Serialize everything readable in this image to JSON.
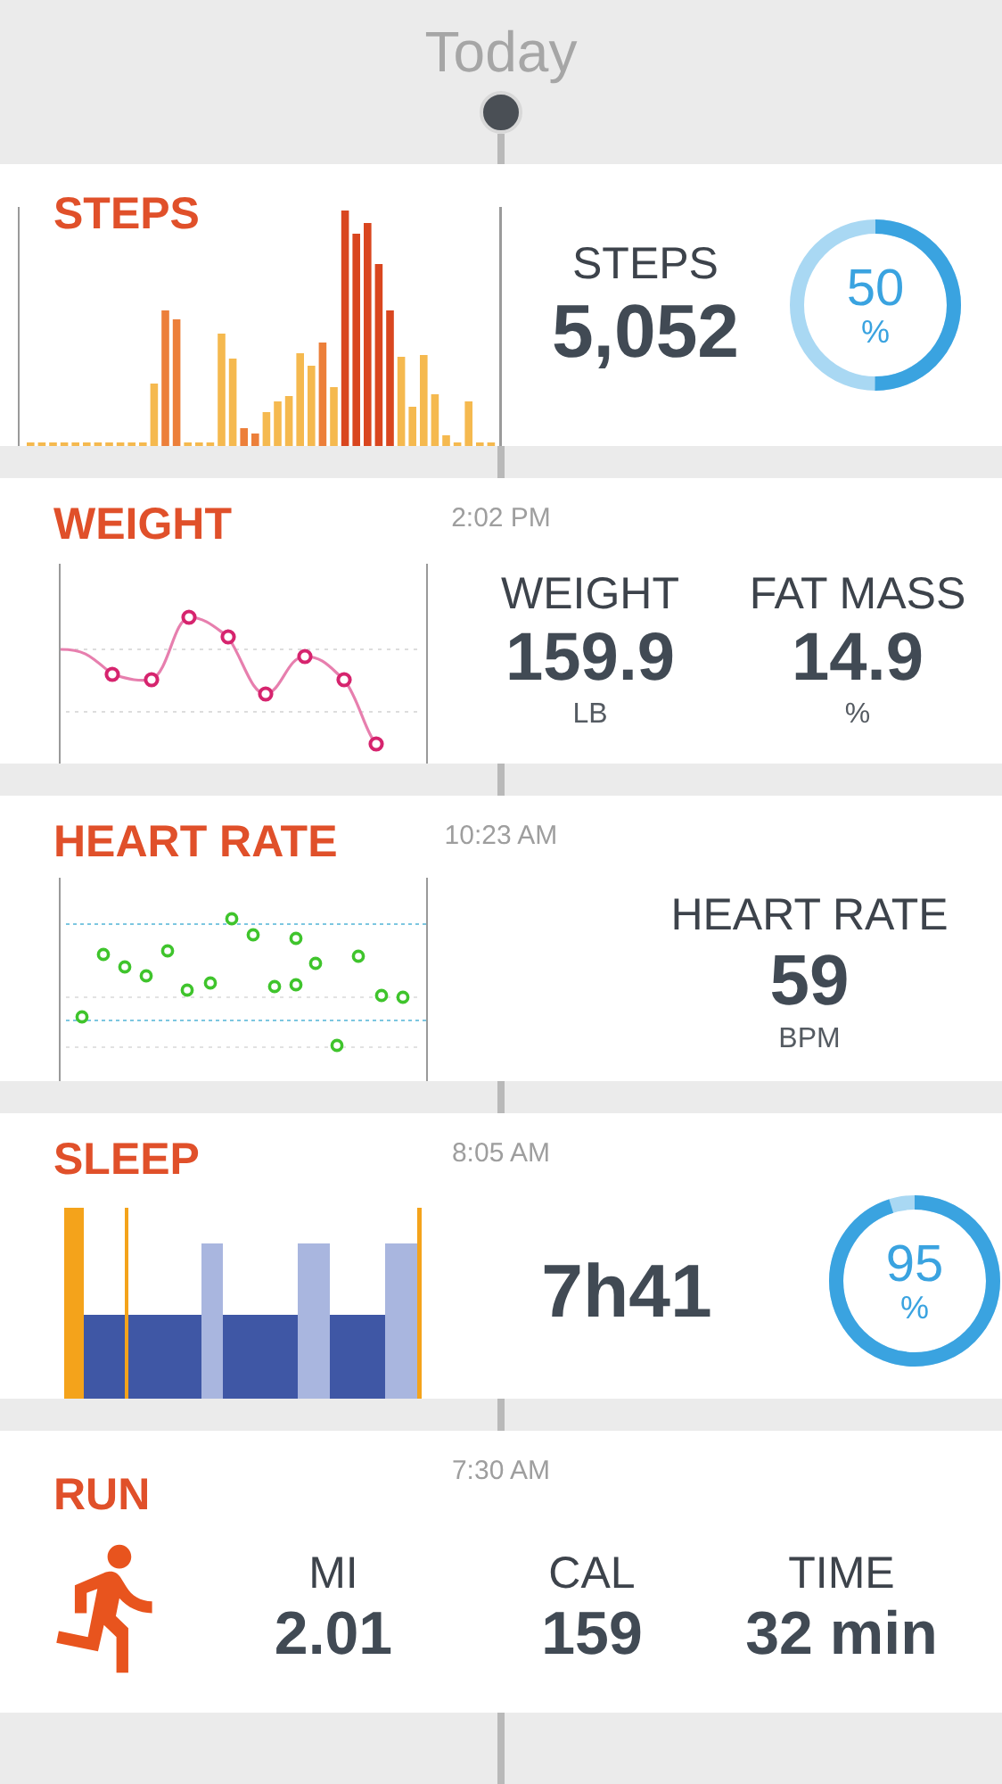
{
  "header": {
    "title": "Today"
  },
  "cards": [
    {
      "kind": "steps",
      "title": "STEPS",
      "label": "STEPS",
      "value": "5,052",
      "ring": {
        "value": "50",
        "unit": "%",
        "level": 0.5
      }
    },
    {
      "kind": "weight",
      "title": "WEIGHT",
      "time": "2:02 PM",
      "stats": [
        {
          "label": "WEIGHT",
          "value": "159.9",
          "unit": "LB"
        },
        {
          "label": "FAT MASS",
          "value": "14.9",
          "unit": "%"
        }
      ]
    },
    {
      "kind": "heart",
      "title": "HEART RATE",
      "time": "10:23 AM",
      "stats": [
        {
          "label": "HEART RATE",
          "value": "59",
          "unit": "BPM"
        }
      ]
    },
    {
      "kind": "sleep",
      "title": "SLEEP",
      "time": "8:05 AM",
      "value": "7h41",
      "ring": {
        "value": "95",
        "unit": "%",
        "level": 0.95
      }
    },
    {
      "kind": "run",
      "title": "RUN",
      "time": "7:30 AM",
      "stats": [
        {
          "label": "MI",
          "value": "2.01"
        },
        {
          "label": "CAL",
          "value": "159"
        },
        {
          "label": "TIME",
          "value": "32 min"
        }
      ]
    }
  ]
}
